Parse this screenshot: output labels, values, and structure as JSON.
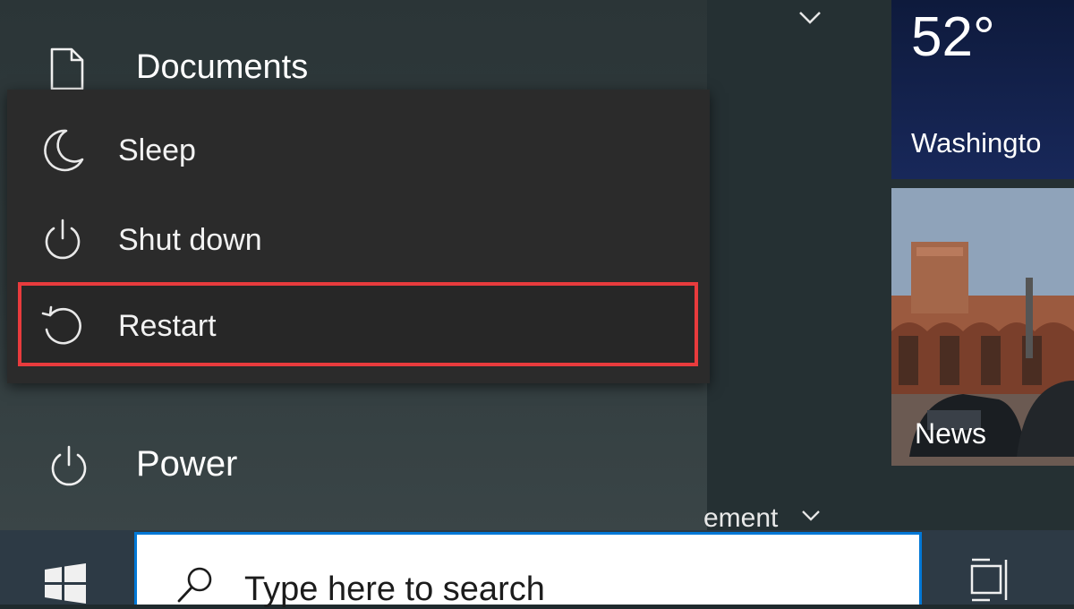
{
  "start_menu": {
    "documents_label": "Documents",
    "power_label": "Power",
    "section_partial_label": "ement"
  },
  "power_menu": {
    "items": [
      {
        "label": "Sleep",
        "icon": "moon-icon"
      },
      {
        "label": "Shut down",
        "icon": "power-icon"
      },
      {
        "label": "Restart",
        "icon": "restart-icon"
      }
    ],
    "highlighted": "Restart",
    "highlight_color": "#e83b3d"
  },
  "tiles": {
    "weather": {
      "temperature": "52°",
      "location": "Washingto"
    },
    "news": {
      "label": "News"
    }
  },
  "taskbar": {
    "search_placeholder": "Type here to search",
    "accent": "#0078d7"
  }
}
